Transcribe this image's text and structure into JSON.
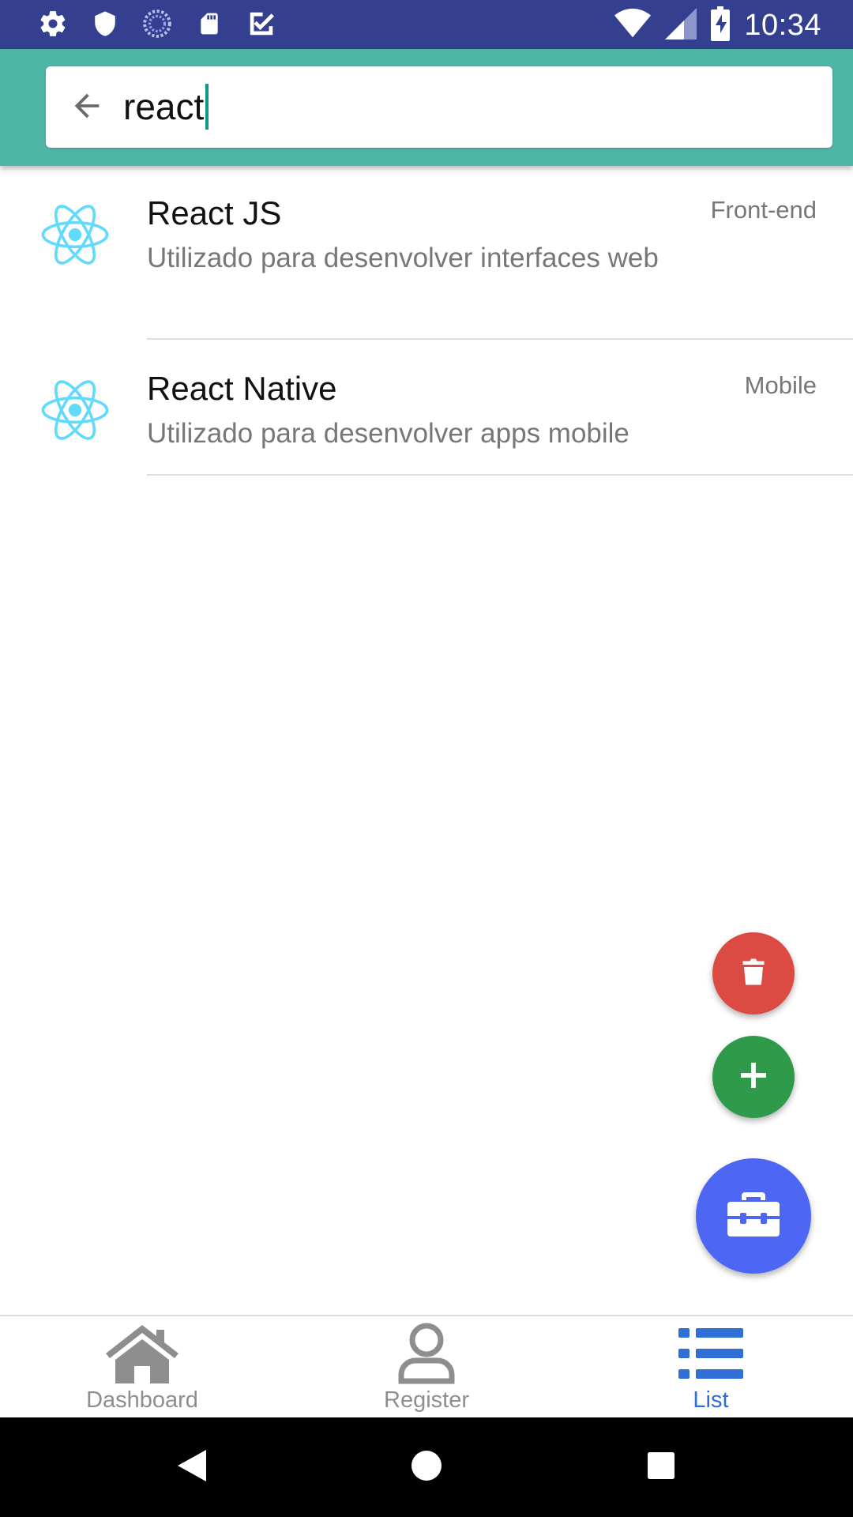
{
  "status_bar": {
    "time": "10:34",
    "left_icons": [
      "settings-icon",
      "shield-icon",
      "sync-icon",
      "sd-card-icon",
      "task-icon"
    ],
    "right_icons": [
      "wifi-icon",
      "signal-icon",
      "battery-charging-icon"
    ]
  },
  "search": {
    "value": "react",
    "back_icon": "arrow-left-icon"
  },
  "results": [
    {
      "title": "React JS",
      "description": "Utilizado para desenvolver interfaces web",
      "tag": "Front-end",
      "icon": "react-logo-icon"
    },
    {
      "title": "React Native",
      "description": "Utilizado para desenvolver apps mobile",
      "tag": "Mobile",
      "icon": "react-logo-icon"
    }
  ],
  "fabs": {
    "delete": {
      "icon": "trash-icon",
      "color": "#dc4b43"
    },
    "add": {
      "icon": "plus-icon",
      "color": "#2e9a4a"
    },
    "main": {
      "icon": "toolbox-icon",
      "color": "#4d66f3"
    }
  },
  "tabs": [
    {
      "label": "Dashboard",
      "icon": "home-icon",
      "active": false
    },
    {
      "label": "Register",
      "icon": "user-icon",
      "active": false
    },
    {
      "label": "List",
      "icon": "list-icon",
      "active": true
    }
  ],
  "colors": {
    "status_bar": "#353f8f",
    "app_bar": "#4fb6a7",
    "active_tab": "#2f6fd6",
    "react_logo": "#61dafb"
  }
}
